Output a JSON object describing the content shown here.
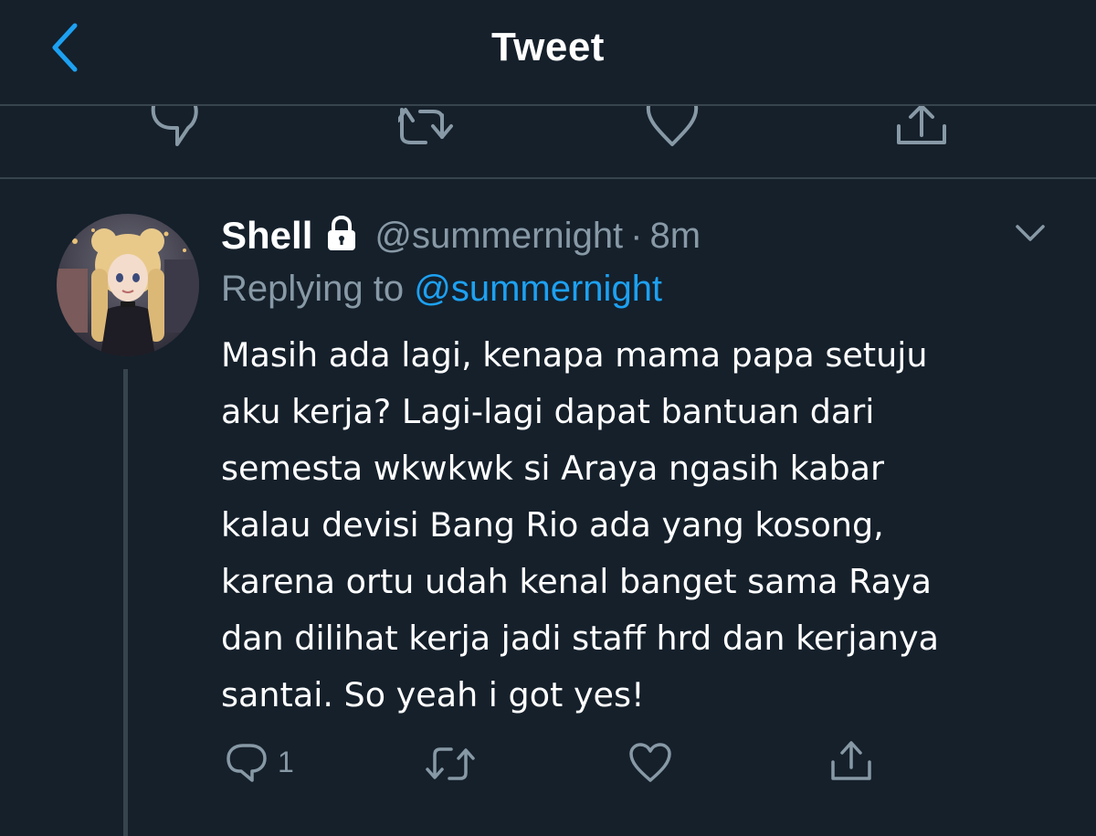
{
  "header": {
    "title": "Tweet",
    "back_icon": "chevron-left-icon",
    "accent_color": "#1da1f2"
  },
  "parent_actions": {
    "icons": [
      "reply-icon",
      "retweet-icon",
      "like-icon",
      "share-icon"
    ]
  },
  "reply": {
    "display_name": "Shell",
    "protected_icon": "lock-icon",
    "handle": "@summernight",
    "separator": "·",
    "time": "8m",
    "replying_prefix": "Replying to",
    "replying_to": "@summernight",
    "text": "Masih ada lagi, kenapa mama papa setuju\naku kerja? Lagi-lagi dapat bantuan dari\nsemesta wkwkwk si Araya ngasih kabar\nkalau devisi Bang Rio ada yang kosong,\nkarena ortu udah kenal banget sama Raya\ndan dilihat kerja jadi staff hrd dan kerjanya\nsantai. So yeah i got yes!",
    "reply_count": "1",
    "actions": [
      "reply-icon",
      "retweet-icon",
      "like-icon",
      "share-icon"
    ]
  },
  "colors": {
    "background": "#15202b",
    "border": "#38444d",
    "secondary_text": "#8899a6",
    "link": "#1da1f2"
  }
}
